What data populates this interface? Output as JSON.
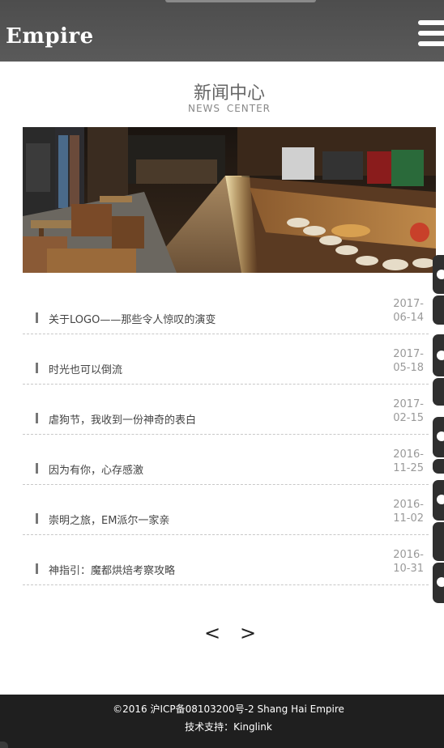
{
  "header": {
    "logo": "Empire"
  },
  "section": {
    "title": "新闻中心",
    "subtitle": "NEWS  CENTER"
  },
  "news": [
    {
      "title": "关于LOGO——那些令人惊叹的演变",
      "year": "2017-",
      "md": "06-14"
    },
    {
      "title": "时光也可以倒流",
      "year": "2017-",
      "md": "05-18"
    },
    {
      "title": "虐狗节，我收到一份神奇的表白",
      "year": "2017-",
      "md": "02-15"
    },
    {
      "title": "因为有你，心存感激",
      "year": "2016-",
      "md": "11-25"
    },
    {
      "title": "崇明之旅，EM派尔一家亲",
      "year": "2016-",
      "md": "11-02"
    },
    {
      "title": "神指引：魔都烘焙考察攻略",
      "year": "2016-",
      "md": "10-31"
    }
  ],
  "pager": {
    "prev": "<",
    "next": ">"
  },
  "footer": {
    "line1": "©2016  沪ICP备08103200号-2 Shang  Hai  Empire",
    "line2": "技术支持：Kinglink"
  }
}
